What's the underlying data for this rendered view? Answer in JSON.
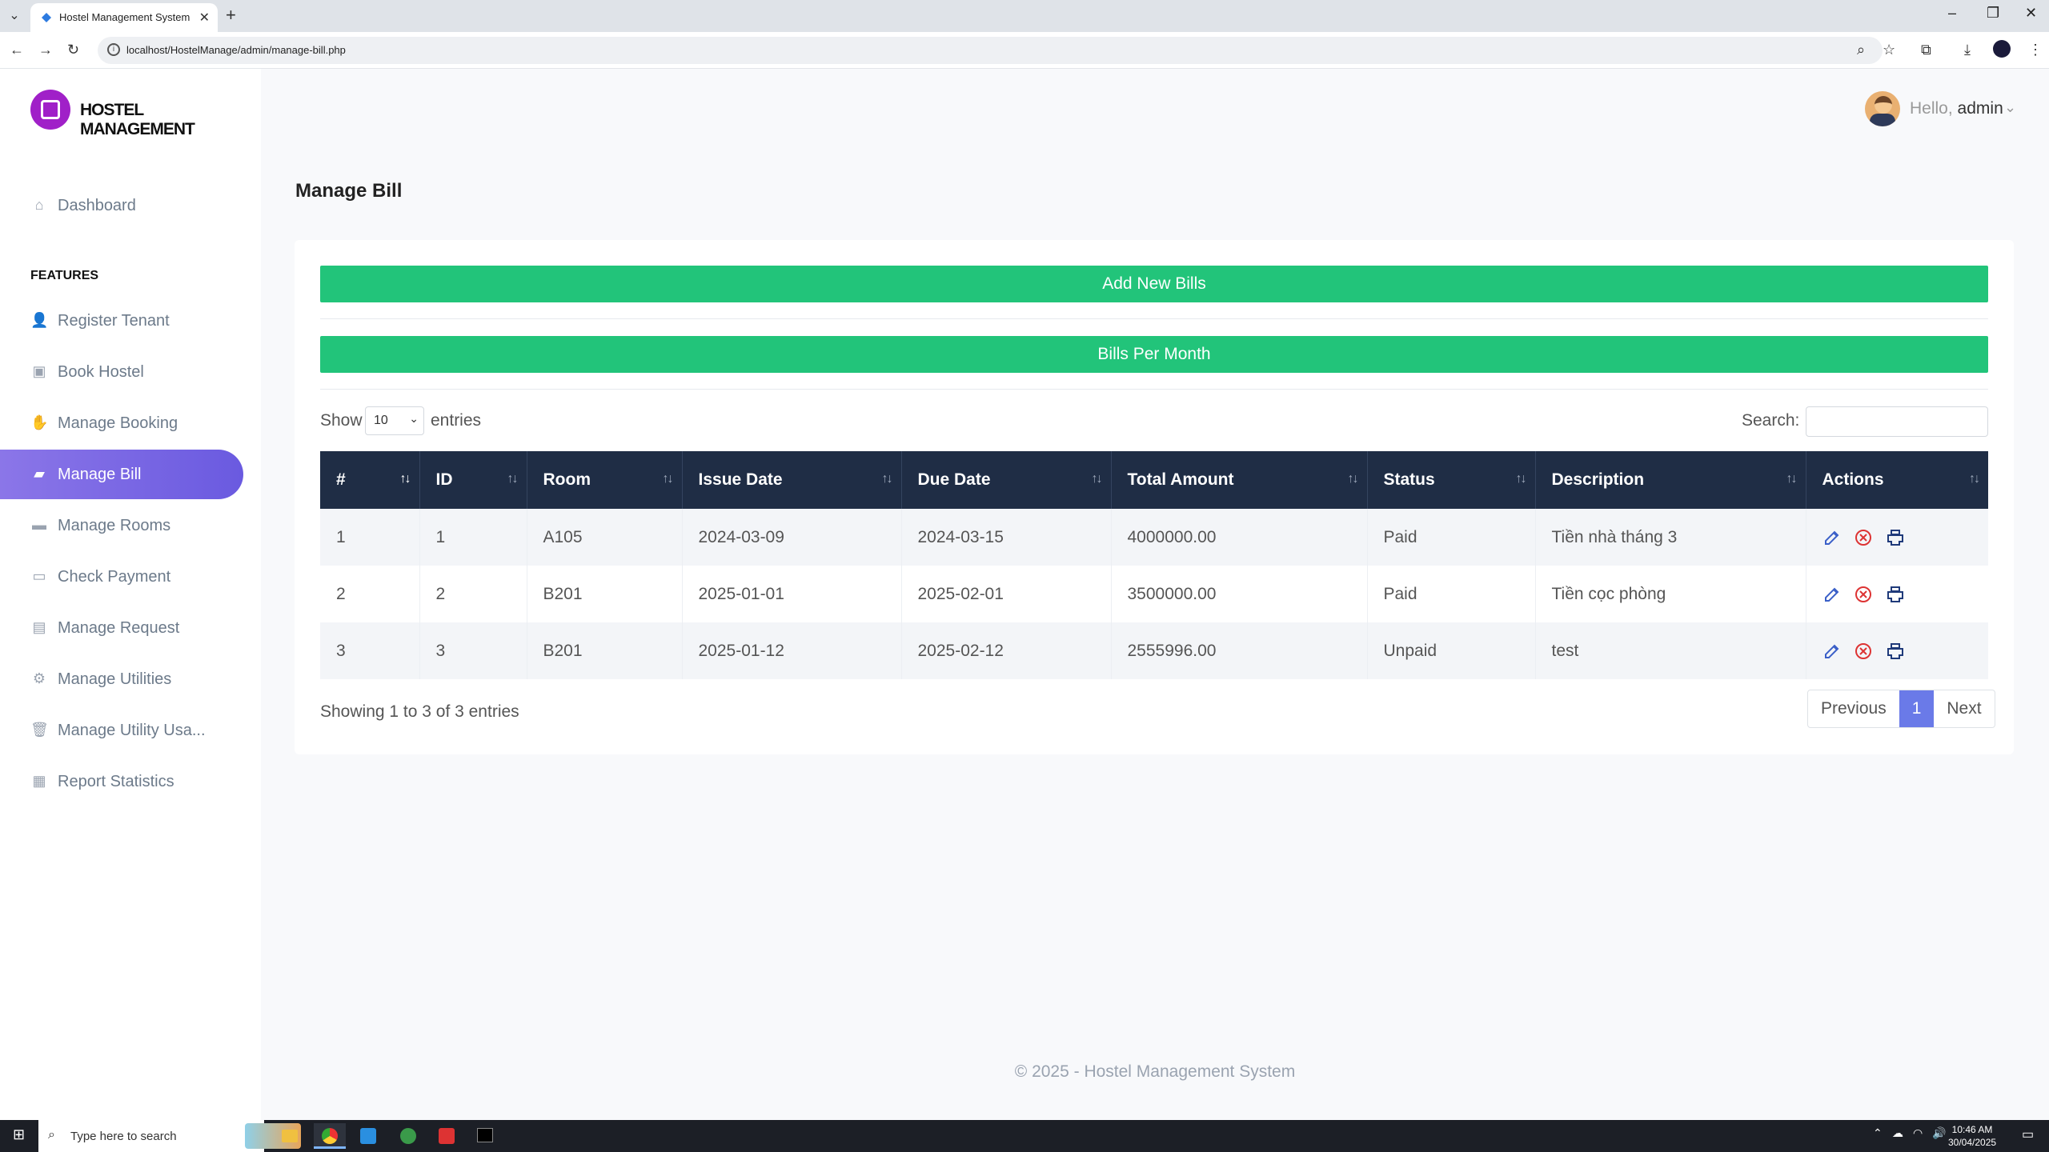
{
  "browser": {
    "tab_title": "Hostel Management System",
    "url": "localhost/HostelManage/admin/manage-bill.php"
  },
  "brand": {
    "name": "HOSTEL MANAGEMENT",
    "color": "#a020c8"
  },
  "sidebar": {
    "dashboard": "Dashboard",
    "heading": "FEATURES",
    "items": [
      {
        "label": "Register Tenant",
        "icon": "user-plus-icon"
      },
      {
        "label": "Book Hostel",
        "icon": "book-icon"
      },
      {
        "label": "Manage Booking",
        "icon": "handshake-icon"
      },
      {
        "label": "Manage Bill",
        "icon": "folder-open-icon",
        "active": true
      },
      {
        "label": "Manage Rooms",
        "icon": "bed-icon"
      },
      {
        "label": "Check Payment",
        "icon": "credit-card-icon"
      },
      {
        "label": "Manage Request",
        "icon": "inbox-icon"
      },
      {
        "label": "Manage Utilities",
        "icon": "cogs-icon"
      },
      {
        "label": "Manage Utility Usa...",
        "icon": "trash-icon"
      },
      {
        "label": "Report Statistics",
        "icon": "calculator-icon"
      }
    ],
    "active_color": "#6a5ae0"
  },
  "header": {
    "greeting": "Hello,",
    "user": "admin"
  },
  "page": {
    "title": "Manage Bill",
    "add_button": "Add New Bills",
    "per_month_button": "Bills Per Month",
    "button_color": "#22c47a",
    "show_label": "Show",
    "entries_value": "10",
    "entries_label": "entries",
    "search_label": "Search:"
  },
  "table": {
    "columns": [
      "#",
      "ID",
      "Room",
      "Issue Date",
      "Due Date",
      "Total Amount",
      "Status",
      "Description",
      "Actions"
    ],
    "rows": [
      {
        "n": "1",
        "id": "1",
        "room": "A105",
        "issue": "2024-03-09",
        "due": "2024-03-15",
        "total": "4000000.00",
        "status": "Paid",
        "desc": "Tiền nhà tháng 3"
      },
      {
        "n": "2",
        "id": "2",
        "room": "B201",
        "issue": "2025-01-01",
        "due": "2025-02-01",
        "total": "3500000.00",
        "status": "Paid",
        "desc": "Tiền cọc phòng"
      },
      {
        "n": "3",
        "id": "3",
        "room": "B201",
        "issue": "2025-01-12",
        "due": "2025-02-12",
        "total": "2555996.00",
        "status": "Unpaid",
        "desc": "test"
      }
    ],
    "header_color": "#1f2d45"
  },
  "pagination": {
    "info": "Showing 1 to 3 of 3 entries",
    "previous": "Previous",
    "current": "1",
    "next": "Next"
  },
  "footer": "© 2025 - Hostel Management System",
  "taskbar": {
    "search_placeholder": "Type here to search",
    "time": "10:46 AM",
    "date": "30/04/2025"
  }
}
